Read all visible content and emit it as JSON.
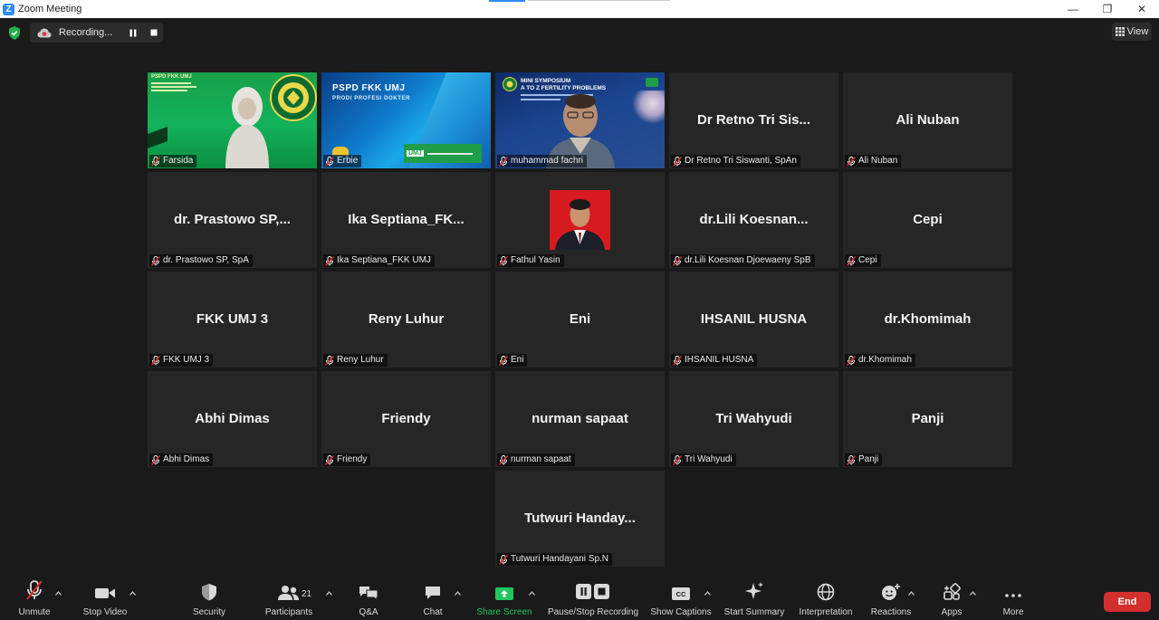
{
  "window": {
    "title": "Zoom Meeting",
    "minimize": "—",
    "restore": "❐",
    "close": "✕"
  },
  "recording": {
    "status": "Recording..."
  },
  "view_button": {
    "label": "View"
  },
  "tiles": [
    {
      "label": "Farsida",
      "display": "",
      "video": "farsida",
      "active": false
    },
    {
      "label": "Erbie",
      "display": "",
      "video": "erbie",
      "active": false
    },
    {
      "label": "muhammad fachri",
      "display": "",
      "video": "fachri",
      "active": true
    },
    {
      "label": "Dr Retno Tri Siswanti, SpAn",
      "display": "Dr Retno Tri Sis...",
      "video": "",
      "active": false
    },
    {
      "label": "Ali Nuban",
      "display": "Ali Nuban",
      "video": "",
      "active": false
    },
    {
      "label": "dr. Prastowo SP, SpA",
      "display": "dr. Prastowo SP,...",
      "video": "",
      "active": false
    },
    {
      "label": "Ika Septiana_FKK UMJ",
      "display": "Ika Septiana_FK...",
      "video": "",
      "active": false
    },
    {
      "label": "Fathul Yasin",
      "display": "",
      "video": "photo",
      "active": false
    },
    {
      "label": "dr.Lili Koesnan Djoewaeny SpB",
      "display": "dr.Lili Koesnan...",
      "video": "",
      "active": false
    },
    {
      "label": "Cepi",
      "display": "Cepi",
      "video": "",
      "active": false
    },
    {
      "label": "FKK UMJ 3",
      "display": "FKK UMJ 3",
      "video": "",
      "active": false
    },
    {
      "label": "Reny Luhur",
      "display": "Reny Luhur",
      "video": "",
      "active": false
    },
    {
      "label": "Eni",
      "display": "Eni",
      "video": "",
      "active": false
    },
    {
      "label": "IHSANIL HUSNA",
      "display": "IHSANIL HUSNA",
      "video": "",
      "active": false
    },
    {
      "label": "dr.Khomimah",
      "display": "dr.Khomimah",
      "video": "",
      "active": false
    },
    {
      "label": "Abhi Dimas",
      "display": "Abhi Dimas",
      "video": "",
      "active": false
    },
    {
      "label": "Friendy",
      "display": "Friendy",
      "video": "",
      "active": false
    },
    {
      "label": "nurman sapaat",
      "display": "nurman sapaat",
      "video": "",
      "active": false
    },
    {
      "label": "Tri Wahyudi",
      "display": "Tri Wahyudi",
      "video": "",
      "active": false
    },
    {
      "label": "Panji",
      "display": "Panji",
      "video": "",
      "active": false
    },
    {
      "label": "Tutwuri Handayani Sp.N",
      "display": "Tutwuri Handay...",
      "video": "",
      "active": false
    }
  ],
  "slides": {
    "farsida_header": "PSPD FKK UMJ",
    "erbie_header": "PSPD FKK UMJ",
    "erbie_sub": "PRODI PROFESI DOKTER",
    "erbie_badge": "UMJ",
    "fachri_title1": "MINI SYMPOSIUM",
    "fachri_title2": "A TO Z FERTILITY PROBLEMS"
  },
  "toolbar": {
    "unmute": "Unmute",
    "stop_video": "Stop Video",
    "security": "Security",
    "participants": "Participants",
    "participants_count": "21",
    "qa": "Q&A",
    "chat": "Chat",
    "share_screen": "Share Screen",
    "pause_stop_recording": "Pause/Stop Recording",
    "show_captions": "Show Captions",
    "captions_badge": "CC",
    "start_summary": "Start Summary",
    "interpretation": "Interpretation",
    "reactions": "Reactions",
    "apps": "Apps",
    "more": "More",
    "end": "End"
  },
  "colors": {
    "accent": "#2d8cff",
    "share": "#22c55e",
    "end": "#d32f2f",
    "active_border": "#e9e47a",
    "muted_icon": "#e02828"
  }
}
